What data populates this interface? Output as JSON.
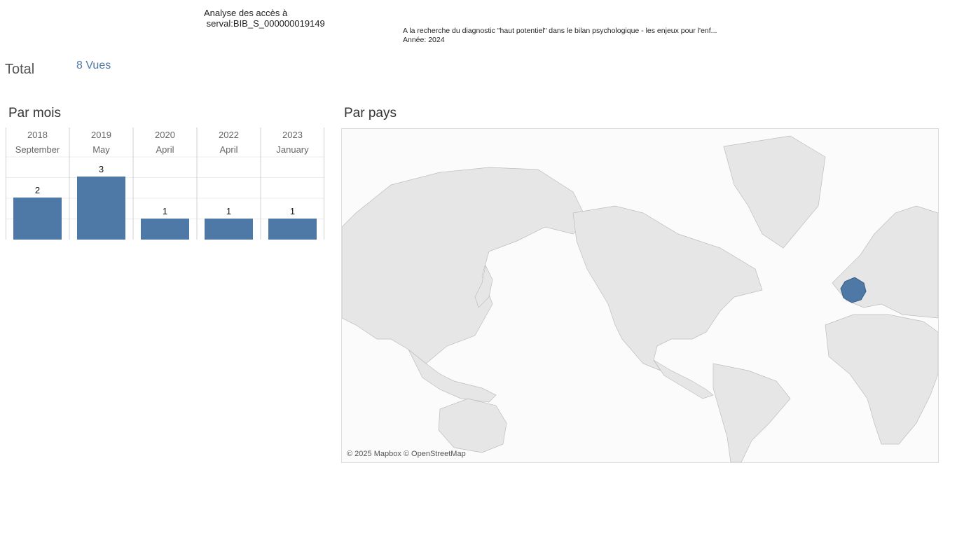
{
  "header": {
    "title": "Analyse des accès à\n serval:BIB_S_000000019149",
    "document_title": "A la recherche du diagnostic \"haut potentiel\" dans le bilan psychologique - les enjeux pour l'enf...",
    "document_year": "Année: 2024"
  },
  "total": {
    "label": "Total",
    "value": "8 Vues"
  },
  "sections": {
    "by_month": "Par mois",
    "by_country": "Par pays"
  },
  "chart_data": {
    "type": "bar",
    "categories": [
      {
        "year": "2018",
        "month": "September"
      },
      {
        "year": "2019",
        "month": "May"
      },
      {
        "year": "2020",
        "month": "April"
      },
      {
        "year": "2022",
        "month": "April"
      },
      {
        "year": "2023",
        "month": "January"
      }
    ],
    "values": [
      2,
      3,
      1,
      1,
      1
    ],
    "ylim": [
      0,
      3
    ],
    "grid": true,
    "color": "#4e79a7"
  },
  "map": {
    "highlighted_country": "France",
    "highlight_color": "#4e79a7",
    "land_color": "#e6e6e6",
    "attribution": "© 2025 Mapbox © OpenStreetMap"
  }
}
